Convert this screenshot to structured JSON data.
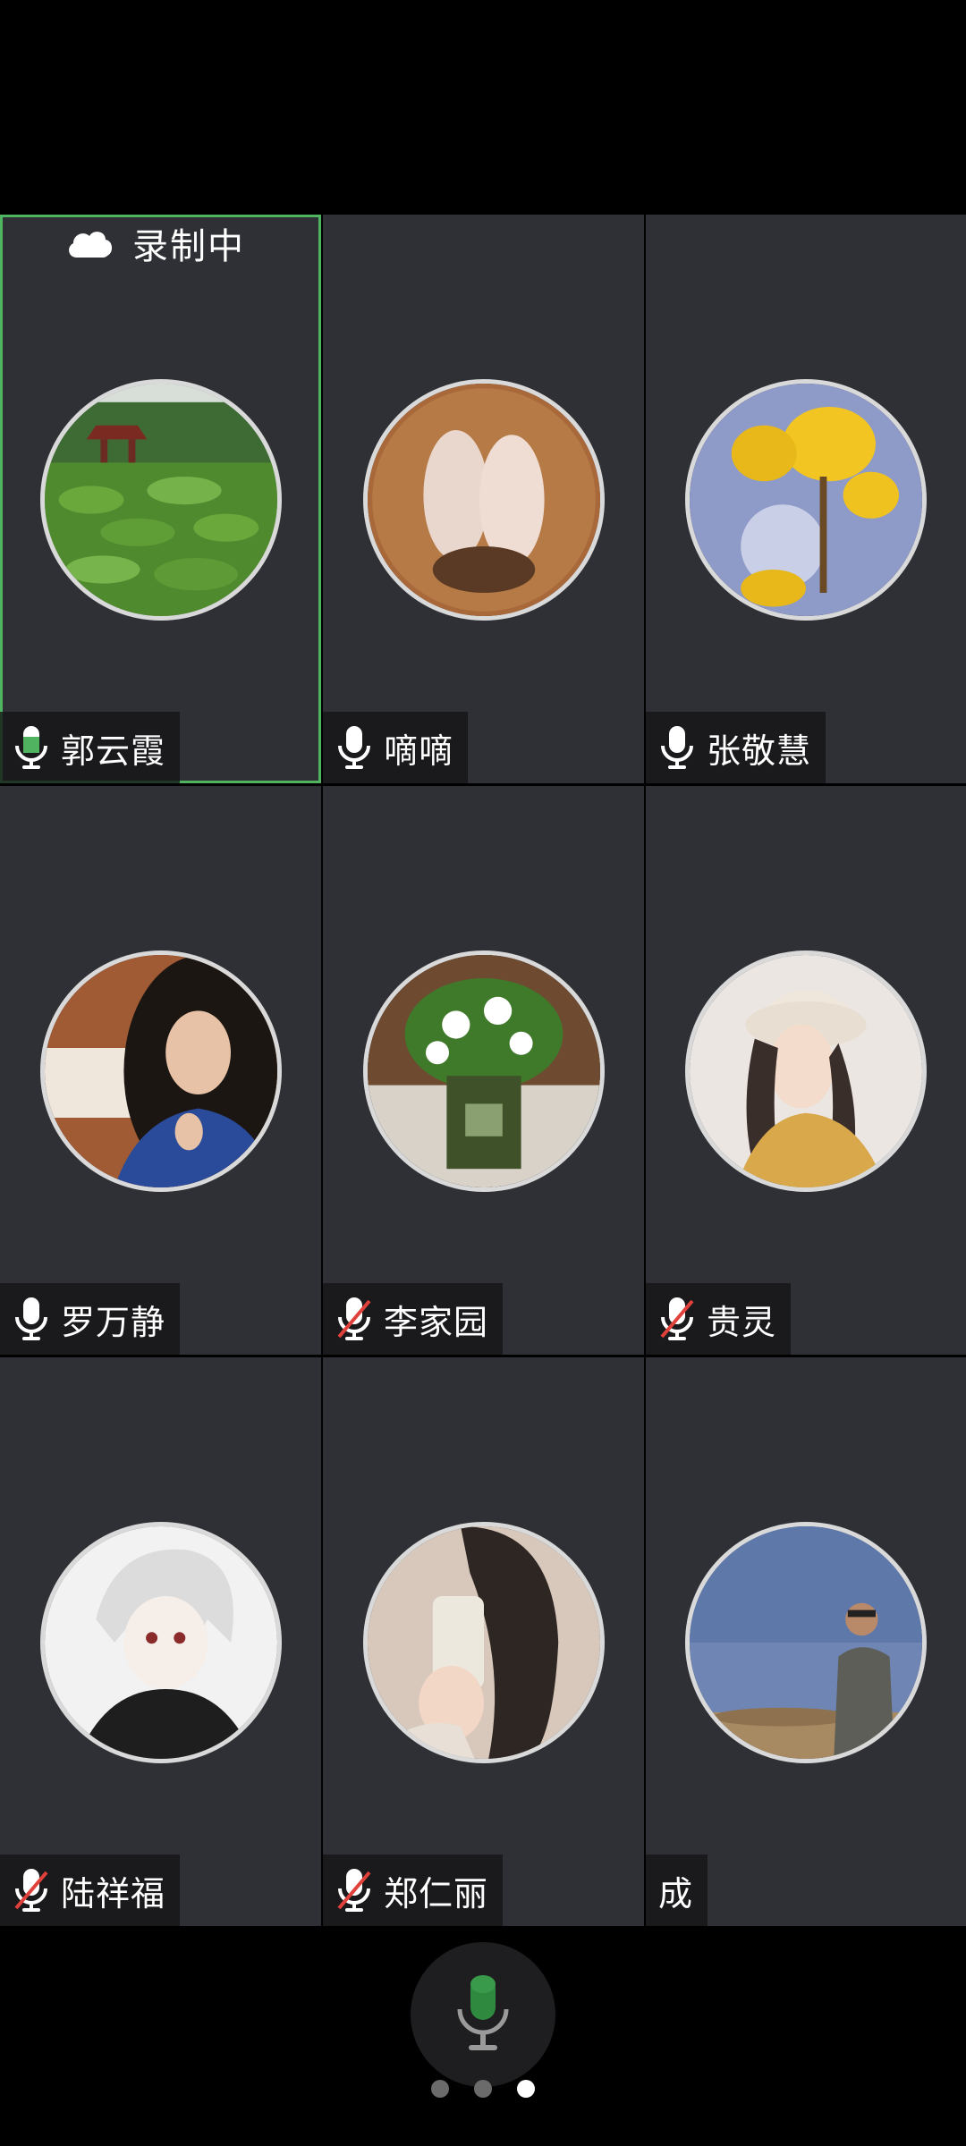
{
  "recording": {
    "label": "录制中",
    "icon": "cloud-icon"
  },
  "participants": [
    {
      "name": "郭云霞",
      "mic": "speaking",
      "active": true,
      "avatar": "lotus-pond-photo"
    },
    {
      "name": "嘀嘀",
      "mic": "on",
      "active": false,
      "avatar": "baby-feet-photo"
    },
    {
      "name": "张敬慧",
      "mic": "on",
      "active": false,
      "avatar": "yellow-flower-photo"
    },
    {
      "name": "罗万静",
      "mic": "on",
      "active": false,
      "avatar": "woman-portrait-photo"
    },
    {
      "name": "李家园",
      "mic": "muted",
      "active": false,
      "avatar": "white-flower-pot-photo"
    },
    {
      "name": "贵灵",
      "mic": "muted",
      "active": false,
      "avatar": "girl-bucket-hat-illustration"
    },
    {
      "name": "陆祥福",
      "mic": "muted",
      "active": false,
      "avatar": "anime-boy-illustration"
    },
    {
      "name": "郑仁丽",
      "mic": "muted",
      "active": false,
      "avatar": "mirror-selfie-photo"
    },
    {
      "name": "成",
      "mic": "none",
      "active": false,
      "avatar": "man-desert-photo"
    }
  ],
  "controls": {
    "mic_button": "microphone-icon"
  },
  "pagination": {
    "count": 3,
    "current": 3
  },
  "colors": {
    "speaking_green": "#4fb35f",
    "muted_red": "#e0413a",
    "tile_bg": "#2f3035"
  }
}
